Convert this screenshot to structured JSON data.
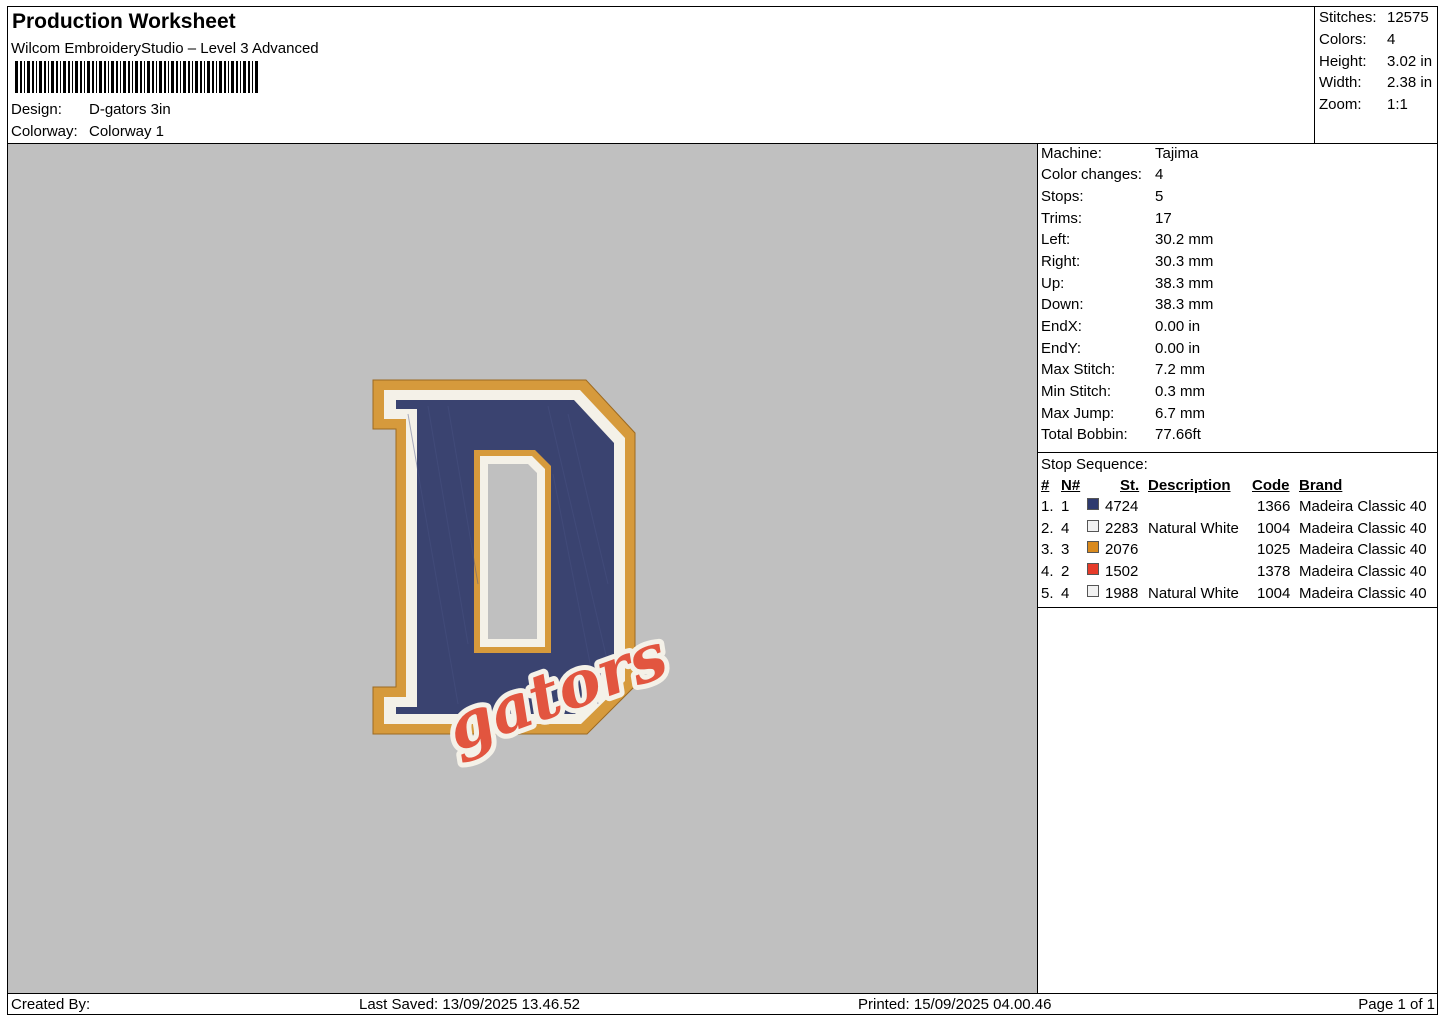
{
  "header": {
    "title": "Production Worksheet",
    "subtitle": "Wilcom EmbroideryStudio – Level 3 Advanced",
    "design_label": "Design:",
    "design_value": "D-gators 3in",
    "colorway_label": "Colorway:",
    "colorway_value": "Colorway 1"
  },
  "stats": [
    {
      "label": "Stitches:",
      "value": "12575"
    },
    {
      "label": "Colors:",
      "value": "4"
    },
    {
      "label": "Height:",
      "value": "3.02 in"
    },
    {
      "label": "Width:",
      "value": "2.38 in"
    },
    {
      "label": "Zoom:",
      "value": "1:1"
    }
  ],
  "machine": [
    {
      "label": "Machine:",
      "value": "Tajima"
    },
    {
      "label": "Color changes:",
      "value": "4"
    },
    {
      "label": "Stops:",
      "value": "5"
    },
    {
      "label": "Trims:",
      "value": "17"
    },
    {
      "label": "Left:",
      "value": "30.2 mm"
    },
    {
      "label": "Right:",
      "value": "30.3 mm"
    },
    {
      "label": "Up:",
      "value": "38.3 mm"
    },
    {
      "label": "Down:",
      "value": "38.3 mm"
    },
    {
      "label": "EndX:",
      "value": "0.00 in"
    },
    {
      "label": "EndY:",
      "value": "0.00 in"
    },
    {
      "label": "Max Stitch:",
      "value": "7.2 mm"
    },
    {
      "label": "Min Stitch:",
      "value": "0.3 mm"
    },
    {
      "label": "Max Jump:",
      "value": "6.7 mm"
    },
    {
      "label": "Total Bobbin:",
      "value": "77.66ft"
    }
  ],
  "stop_sequence": {
    "title": "Stop Sequence:",
    "headers": {
      "num": "#",
      "n": "N#",
      "st": "St.",
      "description": "Description",
      "code": "Code",
      "brand": "Brand"
    },
    "rows": [
      {
        "num": "1.",
        "n": "1",
        "color": "#2e3a6e",
        "st": "4724",
        "description": "",
        "code": "1366",
        "brand": "Madeira Classic 40"
      },
      {
        "num": "2.",
        "n": "4",
        "color": "#f2f2f2",
        "st": "2283",
        "description": "Natural White",
        "code": "1004",
        "brand": "Madeira Classic 40"
      },
      {
        "num": "3.",
        "n": "3",
        "color": "#d98a1e",
        "st": "2076",
        "description": "",
        "code": "1025",
        "brand": "Madeira Classic 40"
      },
      {
        "num": "4.",
        "n": "2",
        "color": "#e63b2a",
        "st": "1502",
        "description": "",
        "code": "1378",
        "brand": "Madeira Classic 40"
      },
      {
        "num": "5.",
        "n": "4",
        "color": "#f2f2f2",
        "st": "1988",
        "description": "Natural White",
        "code": "1004",
        "brand": "Madeira Classic 40"
      }
    ]
  },
  "design_preview": {
    "script_text": "gators",
    "colors": {
      "navy": "#3a4370",
      "white": "#f4f1e8",
      "gold": "#d69a3c",
      "red": "#e2553f",
      "background": "#c0c0c0"
    }
  },
  "footer": {
    "created_by": "Created By:",
    "last_saved": "Last Saved: 13/09/2025 13.46.52",
    "printed": "Printed: 15/09/2025 04.00.46",
    "page": "Page 1 of 1"
  }
}
